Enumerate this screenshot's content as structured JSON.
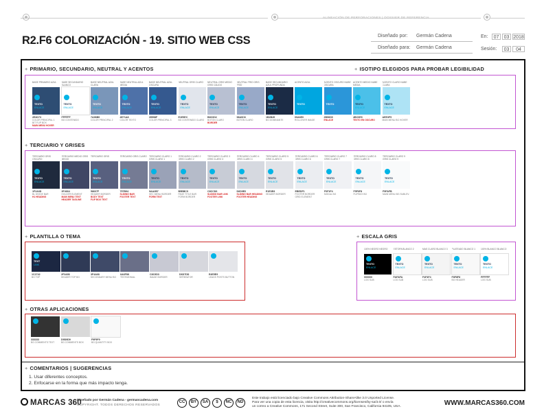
{
  "header": {
    "top_ref": "ALINEACIÓN DE PERFORACIONES | DOSSIER DE REFERENCIA",
    "title": "R2.F6 COLORIZACIÓN - 19. SITIO WEB CSS",
    "designed_by_label": "Diseñado por:",
    "designed_by": "Germán Cadena",
    "designed_for_label": "Diseñado para:",
    "designed_for": "Germán Cadena",
    "date_label": "En:",
    "date_day": "07",
    "date_month": "03",
    "date_year": "2018",
    "session_label": "Sesión:",
    "session_a": "03",
    "session_b": "04"
  },
  "sections": {
    "primary": "PRIMARIO, SECUNDARIO, NEUTRAL Y ACENTOS",
    "isotype": "ISOTIPO ELEGIDOS PARA PROBAR LEGIBILIDAD",
    "tertiary": "TERCIARIO Y GRISES",
    "template": "PLANTILLA O TEMA",
    "grayscale": "ESCALA GRIS",
    "other": "OTRAS APLICACIONES",
    "comments": "COMENTARIOS | SUGERENCIAS"
  },
  "swatch_text": {
    "t1": "TEXTO",
    "t2": "ENLACE"
  },
  "primary_swatches": [
    {
      "name": "BASE PRIMARIO AZUL",
      "color": "#2e4d73",
      "code": "2E4D73",
      "uses": [
        "COLOR PRINCIPAL 1",
        "BIT FLIP BOX"
      ],
      "red": [
        "MAIN MENU HOVER"
      ]
    },
    {
      "name": "BASE SECUNDARIO BLANCO",
      "color": "#ffffff",
      "code": "FFFFFF",
      "uses": [
        "BG CONTENIDO"
      ],
      "red": []
    },
    {
      "name": "BASE NEUTRAL AZUL CLARA",
      "color": "#7a96b9",
      "code": "7A96B9",
      "uses": [
        "COLOR PRINCIPAL 2"
      ],
      "red": []
    },
    {
      "name": "BASE NEUTRAL AZUL MEDIA",
      "color": "#4e71a8",
      "code": "4E71A8",
      "uses": [
        "COLOR TEXTO"
      ],
      "red": []
    },
    {
      "name": "BASE NEUTRAL AZUL OSCURA",
      "color": "#35598f",
      "code": "35598F",
      "uses": [
        "COLOR PRINCIPAL 3"
      ],
      "red": []
    },
    {
      "name": "NEUTRAL GRIS CLARO",
      "color": "#e1e5ec",
      "code": "E1E5EC",
      "uses": [
        "BG CONTENIDO CLARO"
      ],
      "red": []
    },
    {
      "name": "NEUTRAL GRIS MEDIO GRIS CÁLIDO",
      "color": "#b8c0d2",
      "code": "B8C0D2",
      "uses": [
        "BOTÓN CLARO"
      ],
      "red": [
        "BORDER"
      ]
    },
    {
      "name": "NEUTRAL FRÍO GRIS FRÍO",
      "color": "#98a9c8",
      "code": "98A9C8",
      "uses": [
        "BOTÓN CLARO"
      ],
      "red": []
    },
    {
      "name": "BASE SECUNDARIO AZUL PROFUNDA",
      "color": "#1b2b45",
      "code": "1B2B45",
      "uses": [
        "BG DOMINANTE"
      ],
      "red": []
    }
  ],
  "isotype_swatches": [
    {
      "name": "ACENTO AZUL",
      "color": "#00a6e0",
      "code": "00A6E0",
      "uses": [
        "ROLLOVER IMAGE"
      ],
      "red": []
    },
    {
      "name": "ACENTO OSCURO NUBE OSCURA",
      "color": "#2b96d9",
      "code": "2B96D9",
      "uses": [],
      "red": [
        "ENLACE"
      ]
    },
    {
      "name": "ACENTO MEDIO NUBE MEDIA",
      "color": "#4bc0e9",
      "code": "4BC0E9",
      "uses": [],
      "red": [
        "TEXTO EN OSCURO"
      ]
    },
    {
      "name": "ACENTO CLARO NUBE CLARA",
      "color": "#aee3f5",
      "code": "AEE3F5",
      "uses": [
        "MAIN MENU BG HOVER"
      ],
      "red": []
    }
  ],
  "tertiary_swatches": [
    {
      "name": "TERCIARIO GRIS OSCURO",
      "color": "#1f2a3d",
      "code": "1F2A3D",
      "uses": [
        "BL DIVIDE BAR"
      ],
      "red": [
        "H1 HEADING"
      ]
    },
    {
      "name": "TERCIARIO MEDIO GRIS MEDIO",
      "color": "#3f4664",
      "code": "3F4664",
      "uses": [
        "HOLDER ELEMENT"
      ],
      "red": [
        "MAIN MENU TEXT",
        "HEADER TAGLINE"
      ]
    },
    {
      "name": "TERCIARIO GRIS",
      "color": "#58607f",
      "code": "58607F",
      "uses": [
        "HEADER BORDER"
      ],
      "red": [
        "BODY TEXT",
        "FLIP BOX TEXT"
      ]
    },
    {
      "name": "TERCIARIO GRIS CLARO",
      "color": "#757b94",
      "code": "757B94",
      "uses": [],
      "red": [
        "SLIDING BAR",
        "FOOTER TEXT"
      ]
    },
    {
      "name": "TERCIARIO CLARO 1 GRIS CLARO 1",
      "color": "#9aa2b7",
      "code": "9AA2B7",
      "uses": [
        "SEC MENU BORDER"
      ],
      "red": [
        "FORM TEXT"
      ]
    },
    {
      "name": "TERCIARIO CLARO 2 GRIS CLARO 2",
      "color": "#b5bbc9",
      "code": "B5BBC9",
      "uses": [
        "PAGE TITLE BAR",
        "FORM BORDER"
      ],
      "red": []
    },
    {
      "name": "TERCIARIO CLARO 3 GRIS CLARO 3",
      "color": "#c8ccd6",
      "code": "C8CCD6",
      "uses": [],
      "red": [
        "SLIDING BAR LINK",
        "FOOTER LINK"
      ]
    },
    {
      "name": "TERCIARIO CLARO 4 GRIS CLARO 4",
      "color": "#d6d9e0",
      "code": "D6D9E0",
      "uses": [],
      "red": [
        "SLIDING BAR HEADING",
        "FOOTER HEADING"
      ]
    },
    {
      "name": "TERCIARIO CLARO 5 GRIS CLARO 5",
      "color": "#e1e3e8",
      "code": "E1E3E8",
      "uses": [
        "HEADER BORDER"
      ],
      "red": []
    },
    {
      "name": "TERCIARIO CLARO 6 GRIS CLARO 6",
      "color": "#ebedf1",
      "code": "EBEDF1",
      "uses": [
        "FOOTER BORDER",
        "GRID ELEMENT"
      ],
      "red": []
    },
    {
      "name": "TERCIARIO CLARO 7 GRIS CLARO 7",
      "color": "#f0f1f4",
      "code": "F0F1F4",
      "uses": [
        "MODAL BG"
      ],
      "red": []
    },
    {
      "name": "TERCIARIO CLARO 8 GRIS CLARO 8",
      "color": "#f5f6f8",
      "code": "F5F6F8",
      "uses": [
        "FLIPBOX BG"
      ],
      "red": []
    },
    {
      "name": "TERCIARIO CLARO 9 GRIS CLARO 9",
      "color": "#f9fafb",
      "code": "F9FAFB",
      "uses": [
        "MAIN MENU BG SUBLEV."
      ],
      "red": []
    }
  ],
  "template_swatches": [
    {
      "color": "#1c2742",
      "code": "1C2742",
      "use": "BG TOP"
    },
    {
      "color": "#2f3a56",
      "code": "2F3A56",
      "use": "HEADER TOP BG"
    },
    {
      "color": "#3f4a68",
      "code": "3F4A68",
      "use": "SECONDARY MENU BG"
    },
    {
      "color": "#6a6f88",
      "code": "6A6F88",
      "use": "TESTIMONIAL"
    },
    {
      "color": "#c8c9d3",
      "code": "C8C9D3",
      "use": "IMAGE BORDER"
    },
    {
      "color": "#d6d7dd",
      "code": "D6D7DD",
      "use": "SEPARATOR"
    },
    {
      "color": "#e4e5e9",
      "code": "E4E5E9",
      "use": "LEADS POSTS BUTTON"
    }
  ],
  "template_text": {
    "t1": "TEXT",
    "t2": "LINK"
  },
  "gray_swatches": [
    {
      "name": "100% NEGRO NEGRO",
      "color": "#000000",
      "code": "000000",
      "use": "LOG SUB"
    },
    {
      "name": "ESTOPA BLANCO 2",
      "color": "#fafafa",
      "code": "FAFAFA",
      "use": "LOG SUB"
    },
    {
      "name": "MAS CLARO BLANCO 3",
      "color": "#f4f4f4",
      "code": "F4F4F4",
      "use": "LOG SUB"
    },
    {
      "name": "PLATEADO BLANCO 1",
      "color": "#f8f8f8",
      "code": "F8F8F8",
      "use": "BG HEADER"
    },
    {
      "name": "100% BLANCO BLANCO",
      "color": "#ffffff",
      "code": "FFFFFF",
      "use": "LOG SUB"
    }
  ],
  "other_swatches": [
    {
      "color": "#333333",
      "code": "333333",
      "use": "BG COMMENTS TEXT"
    },
    {
      "color": "#d9d9d9",
      "code": "D9D9D9",
      "use": "BG COMMENTS BOX"
    },
    {
      "color": "#f9f9f9",
      "code": "F9F9F9",
      "use": "BG QUANTITY BOX"
    }
  ],
  "comments": [
    "1. Usar diferentes conceptos.",
    "2. Enfocarse en la forma que más impacto tenga."
  ],
  "footer": {
    "logo": "MARCAS 360",
    "credit1": "Diseñado por Germán Cadena - germancadena.com",
    "credit2": "COPYRIGHT. TODOS DERECHOS RESERVADOS",
    "license1": "Este trabajo está licenciado bajo Creative Commons Attribution-ShareAlike 3.0 Unported License.",
    "license2": "Para ver una copia de esta licencia, visita http://creativecommons.org/licenses/by-sa/3.0/ o envía",
    "license3": "un correo a Creative Commons, 171 Second Street, Suite 300, San Francisco, California 94105, USA.",
    "url": "WWW.MARCAS360.COM",
    "cc_icons": [
      "CC",
      "BY",
      "SA",
      "$",
      "NC",
      "ND"
    ]
  }
}
